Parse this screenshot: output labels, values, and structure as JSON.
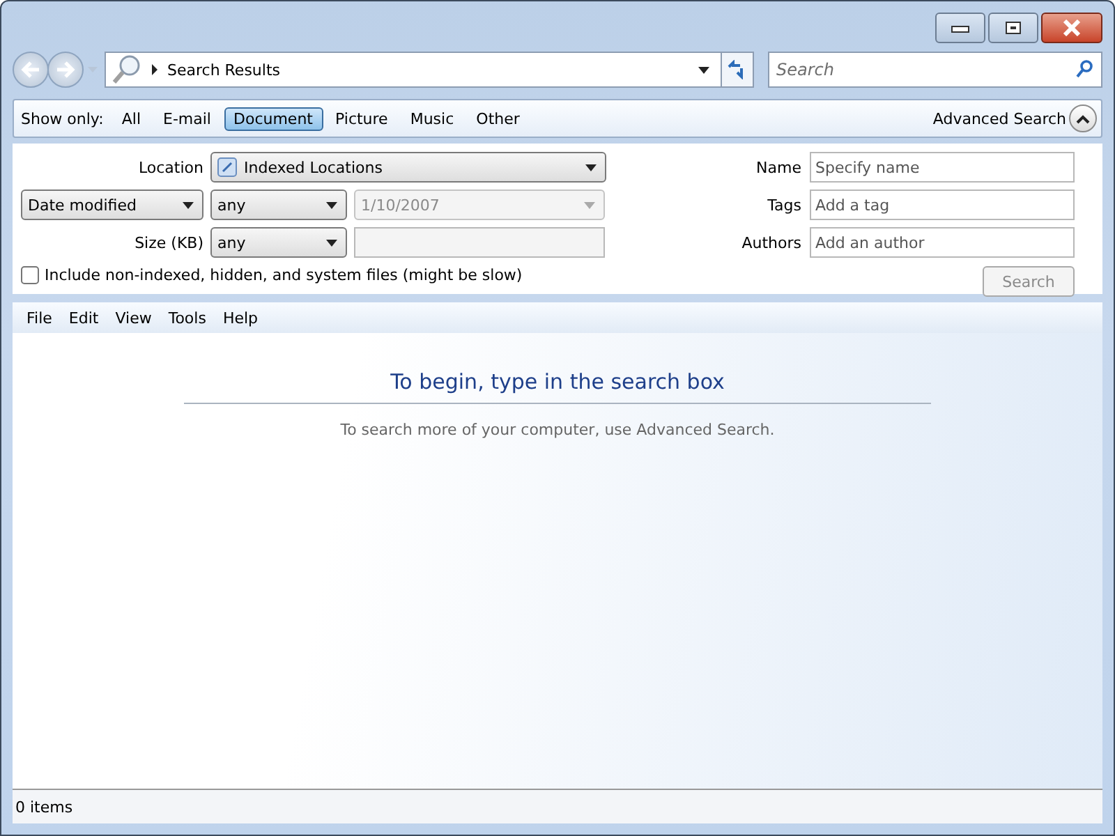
{
  "address_bar": {
    "path": "Search Results"
  },
  "search_box": {
    "placeholder": "Search"
  },
  "show_only": {
    "label": "Show only:",
    "filters": [
      {
        "label": "All",
        "selected": false
      },
      {
        "label": "E-mail",
        "selected": false
      },
      {
        "label": "Document",
        "selected": true
      },
      {
        "label": "Picture",
        "selected": false
      },
      {
        "label": "Music",
        "selected": false
      },
      {
        "label": "Other",
        "selected": false
      }
    ]
  },
  "advanced_search": {
    "label": "Advanced Search",
    "expanded": true
  },
  "location": {
    "label": "Location",
    "value": "Indexed Locations"
  },
  "date_filter": {
    "field": "Date modified",
    "operator": "any",
    "value": "1/10/2007",
    "disabled": true
  },
  "size_filter": {
    "label": "Size (KB)",
    "operator": "any",
    "disabled": true
  },
  "include_all": {
    "label": "Include non-indexed, hidden, and system files (might be slow)",
    "checked": false
  },
  "text_filters": [
    {
      "label": "Name",
      "placeholder": "Specify name"
    },
    {
      "label": "Tags",
      "placeholder": "Add a tag"
    },
    {
      "label": "Authors",
      "placeholder": "Add an author"
    }
  ],
  "search_button": {
    "label": "Search",
    "disabled": true
  },
  "menu": [
    "File",
    "Edit",
    "View",
    "Tools",
    "Help"
  ],
  "message": {
    "heading": "To begin, type in the search box",
    "text": "To search more of your computer, use Advanced Search."
  },
  "status_bar": {
    "text": "0 items"
  }
}
